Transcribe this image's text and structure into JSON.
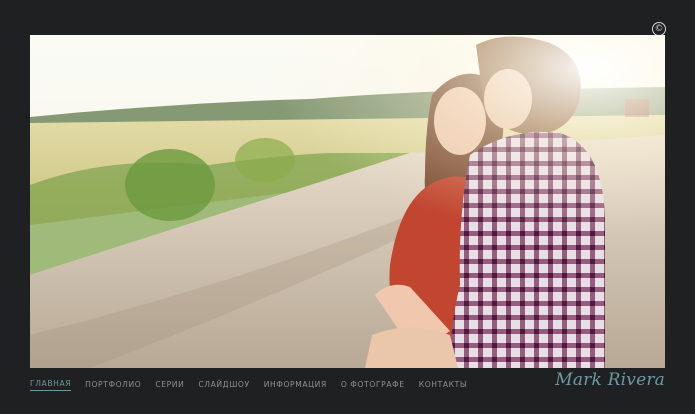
{
  "copyright_symbol": "©",
  "nav": {
    "items": [
      {
        "label": "ГЛАВНАЯ",
        "active": true
      },
      {
        "label": "ПОРТФОЛИО",
        "active": false
      },
      {
        "label": "СЕРИИ",
        "active": false
      },
      {
        "label": "СЛАЙДШОУ",
        "active": false
      },
      {
        "label": "ИНФОРМАЦИЯ",
        "active": false
      },
      {
        "label": "О ФОТОГРАФЕ",
        "active": false
      },
      {
        "label": "КОНТАКТЫ",
        "active": false
      }
    ]
  },
  "signature": "Mark Rivera",
  "colors": {
    "background": "#1f2021",
    "accent": "#6a9aa4",
    "nav_text": "#8e9192"
  }
}
